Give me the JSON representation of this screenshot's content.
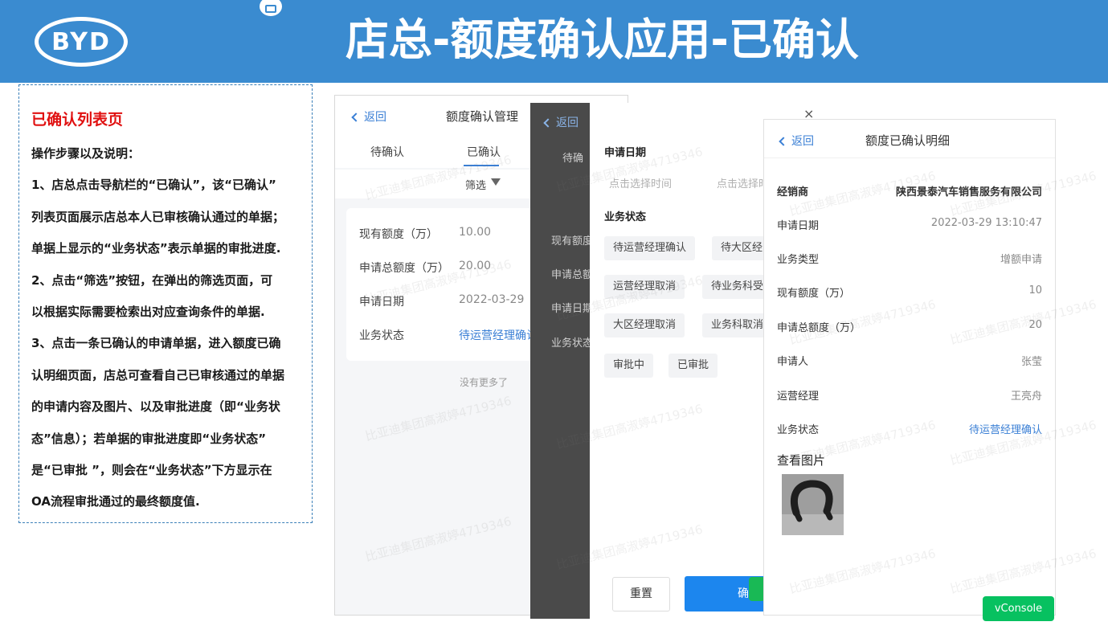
{
  "header": {
    "logo_text": "BYD",
    "title": "店总-额度确认应用-已确认",
    "colors": {
      "banner": "#3a8bd0"
    }
  },
  "instructions": {
    "heading": "已确认列表页",
    "lines": [
      "操作步骤以及说明：",
      "1、店总点击导航栏的“已确认”，该“已确认”",
      "列表页面展示店总本人已审核确认通过的单据；",
      "单据上显示的“业务状态”表示单据的审批进度.",
      "2、点击“筛选”按钮，在弹出的筛选页面，可",
      "以根据实际需要检索出对应查询条件的单据.",
      "3、点击一条已确认的申请单据，进入额度已确",
      "认明细页面，店总可查看自己已审核通过的单据",
      "的申请内容及图片、以及审批进度（即“业务状",
      "态”信息）；若单据的审批进度即“业务状态”",
      "是“已审批 ”，则会在“业务状态”下方显示在",
      "OA流程审批通过的最终额度值."
    ]
  },
  "list_screen": {
    "back": "返回",
    "title": "额度确认管理",
    "tabs": [
      "待确认",
      "已确认"
    ],
    "filter": "筛选",
    "card": [
      {
        "label": "现有额度（万）",
        "value": "10.00"
      },
      {
        "label": "申请总额度（万）",
        "value": "20.00"
      },
      {
        "label": "申请日期",
        "value": "2022-03-29"
      },
      {
        "label": "业务状态",
        "value": "待运营经理确认"
      }
    ],
    "no_more": "没有更多了"
  },
  "filter_screen": {
    "bg_back": "返回",
    "bg_tab": "待确",
    "bg_rows": [
      "现有额度",
      "申请总额",
      "申请日期",
      "业务状态"
    ],
    "close": "×",
    "date_section": "申请日期",
    "date_start": "点击选择时间",
    "date_end": "点击选择时",
    "status_section": "业务状态",
    "chips": [
      "待运营经理确认",
      "待大区经",
      "运营经理取消",
      "待业务科受",
      "大区经理取消",
      "业务科取消",
      "审批中",
      "已审批"
    ],
    "reset": "重置",
    "confirm": "确"
  },
  "detail_screen": {
    "back": "返回",
    "title": "额度已确认明细",
    "rows": [
      {
        "label": "经销商",
        "value": "陕西景泰汽车销售服务有限公司"
      },
      {
        "label": "申请日期",
        "value": "2022-03-29 13:10:47"
      },
      {
        "label": "业务类型",
        "value": "增额申请"
      },
      {
        "label": "现有额度（万）",
        "value": "10"
      },
      {
        "label": "申请总额度（万）",
        "value": "20"
      },
      {
        "label": "申请人",
        "value": "张莹"
      },
      {
        "label": "运营经理",
        "value": "王亮舟"
      },
      {
        "label": "业务状态",
        "value": "待运营经理确认"
      }
    ],
    "photo_title": "查看图片"
  },
  "vconsole": "vConsole",
  "watermark": "比亚迪集团高淑婷4719346"
}
